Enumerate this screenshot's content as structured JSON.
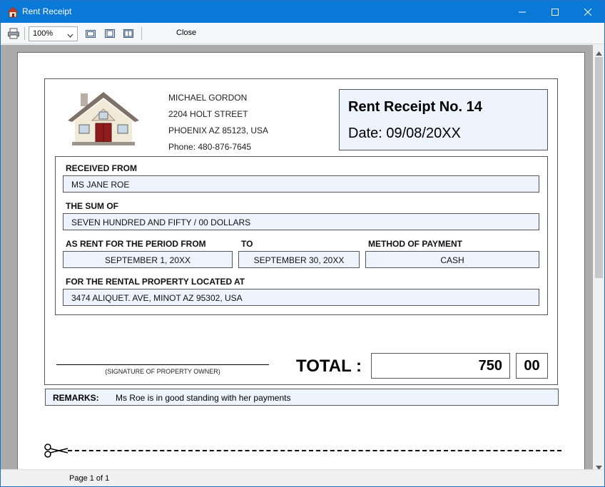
{
  "window": {
    "title": "Rent Receipt"
  },
  "toolbar": {
    "zoom": "100%",
    "close_label": "Close"
  },
  "owner": {
    "name": "MICHAEL GORDON",
    "street": "2204 HOLT STREET",
    "city": "PHOENIX AZ 85123, USA",
    "phone": "Phone: 480-876-7645"
  },
  "receipt": {
    "number_label": "Rent Receipt No. 14",
    "date_label": "Date:  09/08/20XX"
  },
  "fields": {
    "received_from_label": "RECEIVED FROM",
    "received_from": "MS JANE ROE",
    "sum_label": "THE SUM OF",
    "sum": "SEVEN HUNDRED AND FIFTY / 00 DOLLARS",
    "period_from_label": "AS RENT FOR THE PERIOD FROM",
    "period_from": "SEPTEMBER 1, 20XX",
    "to_label": "TO",
    "period_to": "SEPTEMBER 30, 20XX",
    "method_label": "METHOD OF PAYMENT",
    "method": "CASH",
    "property_label": "FOR THE RENTAL PROPERTY LOCATED AT",
    "property": "3474 ALIQUET. AVE, MINOT AZ 95302, USA"
  },
  "signature": {
    "caption": "(SIGNATURE OF PROPERTY OWNER)"
  },
  "total": {
    "label": "TOTAL :",
    "amount": "750",
    "cents": "00"
  },
  "remarks": {
    "label": "REMARKS:",
    "text": "Ms Roe is in good standing with her payments"
  },
  "status": {
    "pages": "Page 1 of 1"
  },
  "colors": {
    "titlebar": "#0a78d7",
    "field_bg": "#eef4fd",
    "viewer_bg": "#ababab"
  },
  "icons": [
    "house-icon",
    "printer-icon",
    "page-setup-icon",
    "single-page-icon",
    "two-page-icon",
    "scissors-icon"
  ]
}
